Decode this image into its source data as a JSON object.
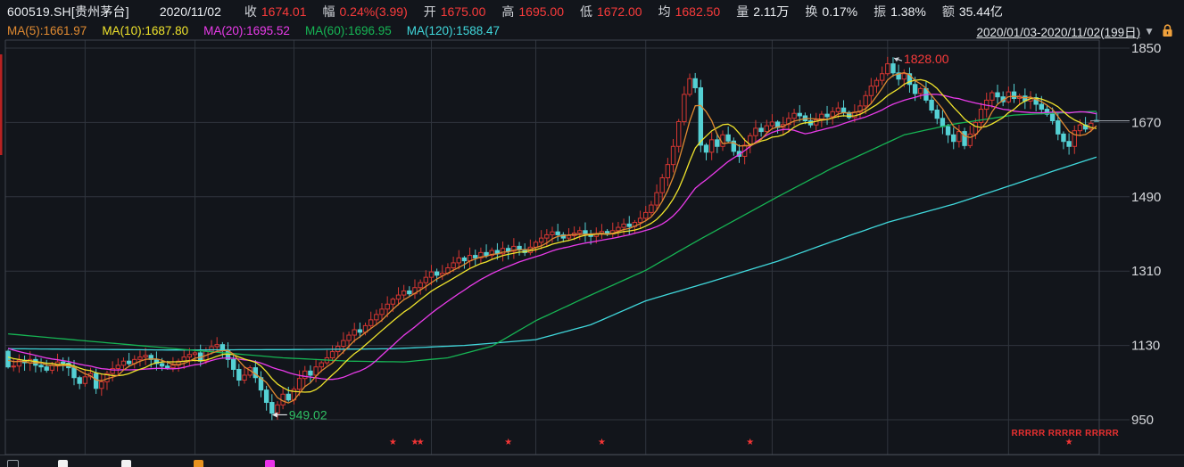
{
  "header": {
    "symbol": "600519.SH[贵州茅台]",
    "date": "2020/11/02",
    "fields": [
      {
        "key": "close",
        "label": "收",
        "value": "1674.01",
        "color": "red"
      },
      {
        "key": "change",
        "label": "幅",
        "value": "0.24%(3.99)",
        "color": "red"
      },
      {
        "key": "open",
        "label": "开",
        "value": "1675.00",
        "color": "red"
      },
      {
        "key": "high",
        "label": "高",
        "value": "1695.00",
        "color": "red"
      },
      {
        "key": "low",
        "label": "低",
        "value": "1672.00",
        "color": "red"
      },
      {
        "key": "avg",
        "label": "均",
        "value": "1682.50",
        "color": "red"
      },
      {
        "key": "volume",
        "label": "量",
        "value": "2.11万",
        "color": "white"
      },
      {
        "key": "turnover",
        "label": "换",
        "value": "0.17%",
        "color": "white"
      },
      {
        "key": "amplitude",
        "label": "振",
        "value": "1.38%",
        "color": "white"
      },
      {
        "key": "amount",
        "label": "额",
        "value": "35.44亿",
        "color": "white"
      }
    ],
    "ma_legend": [
      {
        "key": "ma5",
        "label": "MA(5):",
        "value": "1661.97",
        "color": "#e08a31"
      },
      {
        "key": "ma10",
        "label": "MA(10):",
        "value": "1687.80",
        "color": "#f0e42c"
      },
      {
        "key": "ma20",
        "label": "MA(20):",
        "value": "1695.52",
        "color": "#ea3bea"
      },
      {
        "key": "ma60",
        "label": "MA(60):",
        "value": "1696.95",
        "color": "#16b554"
      },
      {
        "key": "ma120",
        "label": "MA(120):",
        "value": "1588.47",
        "color": "#40d8dc"
      }
    ],
    "range_label": "2020/01/03-2020/11/02(199日)",
    "caret": "▼",
    "lock_color": "#f0a13c"
  },
  "axis": {
    "price_ticks": [
      1850,
      1670,
      1490,
      1310,
      1130,
      950
    ],
    "label_color": "#d5d7db"
  },
  "chart_data": {
    "type": "candlestick",
    "symbol": "600519.SH",
    "period": "2020/01/03-2020/11/02",
    "days": 199,
    "ylim": [
      950,
      1850
    ],
    "colors": {
      "up": "#d73732",
      "down": "#55d1d4",
      "grid": "#30353e",
      "frame": "#3f444d",
      "bg": "#12151b",
      "ma5": "#e08a31",
      "ma10": "#f0e42c",
      "ma20": "#ea3bea",
      "ma60": "#16b554",
      "ma120": "#40d8dc",
      "star": "#f23535",
      "rtext": "#e83030",
      "price_dash": "#9aa0a8",
      "edge_bar": "#b92222"
    },
    "closes": [
      1078,
      1080,
      1094,
      1088,
      1096,
      1082,
      1078,
      1070,
      1082,
      1090,
      1087,
      1076,
      1052,
      1038,
      1054,
      1062,
      1026,
      1042,
      1062,
      1074,
      1082,
      1092,
      1086,
      1096,
      1102,
      1106,
      1096,
      1086,
      1080,
      1076,
      1082,
      1092,
      1102,
      1108,
      1112,
      1092,
      1116,
      1127,
      1132,
      1118,
      1096,
      1072,
      1046,
      1058,
      1076,
      1052,
      1022,
      992,
      966,
      986,
      1012,
      998,
      1024,
      1050,
      1068,
      1058,
      1078,
      1088,
      1100,
      1115,
      1128,
      1142,
      1155,
      1168,
      1162,
      1178,
      1192,
      1205,
      1218,
      1230,
      1242,
      1252,
      1262,
      1255,
      1270,
      1282,
      1295,
      1308,
      1300,
      1305,
      1318,
      1330,
      1342,
      1335,
      1348,
      1342,
      1355,
      1348,
      1360,
      1352,
      1365,
      1358,
      1370,
      1362,
      1355,
      1368,
      1380,
      1390,
      1398,
      1405,
      1398,
      1390,
      1396,
      1402,
      1408,
      1400,
      1394,
      1400,
      1406,
      1400,
      1408,
      1416,
      1424,
      1418,
      1428,
      1438,
      1452,
      1470,
      1500,
      1536,
      1568,
      1612,
      1672,
      1738,
      1776,
      1754,
      1615,
      1598,
      1628,
      1612,
      1640,
      1625,
      1600,
      1588,
      1615,
      1638,
      1656,
      1648,
      1662,
      1671,
      1658,
      1665,
      1680,
      1692,
      1686,
      1674,
      1664,
      1676,
      1690,
      1684,
      1696,
      1705,
      1694,
      1682,
      1695,
      1710,
      1735,
      1758,
      1772,
      1788,
      1812,
      1790,
      1775,
      1788,
      1762,
      1740,
      1752,
      1724,
      1700,
      1680,
      1660,
      1640,
      1624,
      1648,
      1614,
      1642,
      1670,
      1702,
      1724,
      1742,
      1732,
      1720,
      1744,
      1728,
      1734,
      1722,
      1730,
      1714,
      1702,
      1690,
      1674,
      1642,
      1624,
      1612,
      1650,
      1664,
      1654,
      1668,
      1674.01
    ],
    "prehistory": [
      1168,
      1162,
      1155,
      1150,
      1145,
      1140,
      1136,
      1132,
      1128,
      1124,
      1120,
      1115,
      1110,
      1105,
      1100,
      1096,
      1092,
      1088,
      1116
    ],
    "overrides": {
      "48": {
        "low": 949.02
      },
      "161": {
        "high": 1828.0
      },
      "198": {
        "open": 1675.0,
        "high": 1695.0,
        "low": 1672.0,
        "close": 1674.01
      }
    },
    "ma60_anchors": [
      [
        0,
        1158
      ],
      [
        15,
        1140
      ],
      [
        34,
        1118
      ],
      [
        50,
        1100
      ],
      [
        62,
        1092
      ],
      [
        72,
        1090
      ],
      [
        80,
        1100
      ],
      [
        88,
        1128
      ],
      [
        96,
        1190
      ],
      [
        106,
        1252
      ],
      [
        116,
        1312
      ],
      [
        126,
        1388
      ],
      [
        140,
        1490
      ],
      [
        150,
        1560
      ],
      [
        163,
        1640
      ],
      [
        172,
        1666
      ],
      [
        183,
        1688
      ],
      [
        198,
        1697
      ]
    ],
    "ma120_anchors": [
      [
        0,
        1122
      ],
      [
        30,
        1119
      ],
      [
        52,
        1120
      ],
      [
        70,
        1122
      ],
      [
        83,
        1130
      ],
      [
        96,
        1144
      ],
      [
        106,
        1180
      ],
      [
        116,
        1238
      ],
      [
        128,
        1285
      ],
      [
        140,
        1334
      ],
      [
        150,
        1382
      ],
      [
        160,
        1428
      ],
      [
        172,
        1472
      ],
      [
        183,
        1520
      ],
      [
        191,
        1556
      ],
      [
        198,
        1586
      ]
    ],
    "grid_month_days": [
      14,
      34,
      52,
      77,
      96,
      116,
      139,
      160,
      182
    ],
    "annotations": {
      "high": {
        "day": 161,
        "price": 1828.0,
        "label": "1828.00",
        "text_color": "#fa3b3b",
        "arrow_color": "#c8cdd4"
      },
      "low": {
        "day": 48,
        "price": 949.02,
        "label": "949.02",
        "text_color": "#2fbf63",
        "arrow_color": "#e4e7eb"
      }
    },
    "event_stars_days": [
      70,
      74,
      75,
      91,
      108,
      135,
      193
    ],
    "star_glyph": "★",
    "r_text": {
      "text": "RRRRR RRRRR RRRRR",
      "start_day": 183
    },
    "last_price": 1674.01
  },
  "footer": {
    "tools": [
      {
        "name": "tool-select",
        "color": "#9aa0a8",
        "style": "outline",
        "x": 8
      },
      {
        "name": "tool-white-1",
        "color": "#f2f2f2",
        "style": "solid",
        "x": 65
      },
      {
        "name": "tool-white-2",
        "color": "#f2f2f2",
        "style": "solid",
        "x": 136
      },
      {
        "name": "tool-orange",
        "color": "#e8921e",
        "style": "solid",
        "x": 217
      },
      {
        "name": "tool-magenta",
        "color": "#e832e8",
        "style": "solid",
        "x": 297
      }
    ]
  }
}
